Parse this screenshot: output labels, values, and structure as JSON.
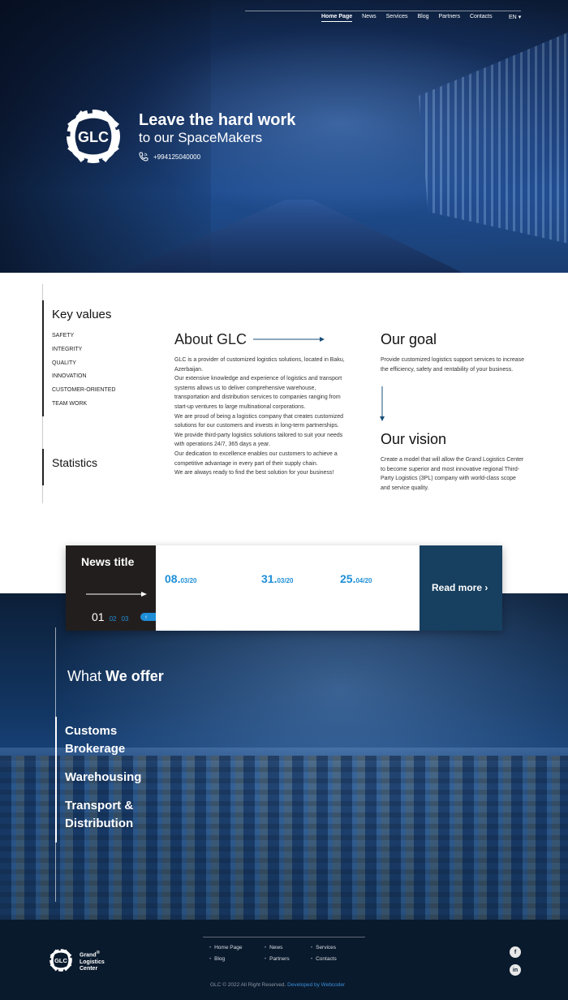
{
  "nav": {
    "items": [
      "Home Page",
      "News",
      "Services",
      "Blog",
      "Partners",
      "Contacts"
    ],
    "active": "Home Page",
    "lang": "EN"
  },
  "hero": {
    "logo_text": "GLC",
    "title": "Leave the hard work",
    "subtitle": "to our SpaceMakers",
    "phone": "+994125040000"
  },
  "key_values": {
    "title": "Key values",
    "items": [
      "SAFETY",
      "INTEGRITY",
      "QUALITY",
      "INNOVATION",
      "CUSTOMER-ORIENTED",
      "TEAM WORK"
    ]
  },
  "statistics": {
    "title": "Statistics"
  },
  "about": {
    "title": "About GLC",
    "paragraphs": [
      "GLC is a provider of customized logistics solutions, located in Baku, Azerbaijan.",
      "Our extensive knowledge and experience of logistics and transport systems allows us to deliver comprehensive warehouse, transportation and distribution services to companies ranging from start-up ventures to large multinational corporations.",
      "We are proud of being a logistics company that creates customized solutions for our customers and invests in long-term partnerships.",
      "We provide third-party logistics solutions tailored to suit your needs with operations 24/7, 365 days a year.",
      "Our dedication to excellence enables our customers to achieve a competitive advantage in every part of their supply chain.",
      "We are always ready to find the best solution for your business!"
    ]
  },
  "goal": {
    "title": "Our goal",
    "text": "Provide customized logistics support services to increase the efficiency, safety and rentability of your business."
  },
  "vision": {
    "title": "Our vision",
    "text": "Create a model that will allow the Grand Logistics Center to become superior and most innovative regional Third-Party Logistics (3PL) company with world-class scope and service quality."
  },
  "news": {
    "title": "News title",
    "current_page": "01",
    "pages": [
      "02",
      "03"
    ],
    "prev": "‹",
    "next": "›",
    "dates": [
      {
        "day": "08.",
        "rest": "03/20"
      },
      {
        "day": "31.",
        "rest": "03/20"
      },
      {
        "day": "25.",
        "rest": "04/20"
      }
    ],
    "read_more": "Read more",
    "read_more_arrow": "›"
  },
  "offer": {
    "title_prefix": "What",
    "title_bold": "We offer",
    "items": [
      {
        "line1": "Customs",
        "line2": "Brokerage"
      },
      {
        "line1": "Warehousing",
        "line2": ""
      },
      {
        "line1": "Transport &",
        "line2": "Distribution"
      }
    ]
  },
  "footer": {
    "logo_text": "GLC",
    "brand_line1": "Grand",
    "brand_sup": "®",
    "brand_line2": "Logistics",
    "brand_line3": "Center",
    "links": [
      "Home Page",
      "News",
      "Services",
      "Blog",
      "Partners",
      "Contacts"
    ],
    "copyright": "GLC © 2022 All Right Reserved.",
    "developer": "Developed by Webcoder",
    "social": [
      "f",
      "in"
    ]
  },
  "colors": {
    "accent": "#1e8fd6",
    "dark_card": "#231e1e",
    "read_more_bg": "#173f5f",
    "footer_bg": "#0a1a2d"
  },
  "icons": [
    "glc-logo-icon",
    "phone-icon",
    "arrow-right-icon",
    "arrow-down-icon",
    "chevron-left-icon",
    "chevron-right-icon",
    "facebook-icon",
    "linkedin-icon"
  ]
}
